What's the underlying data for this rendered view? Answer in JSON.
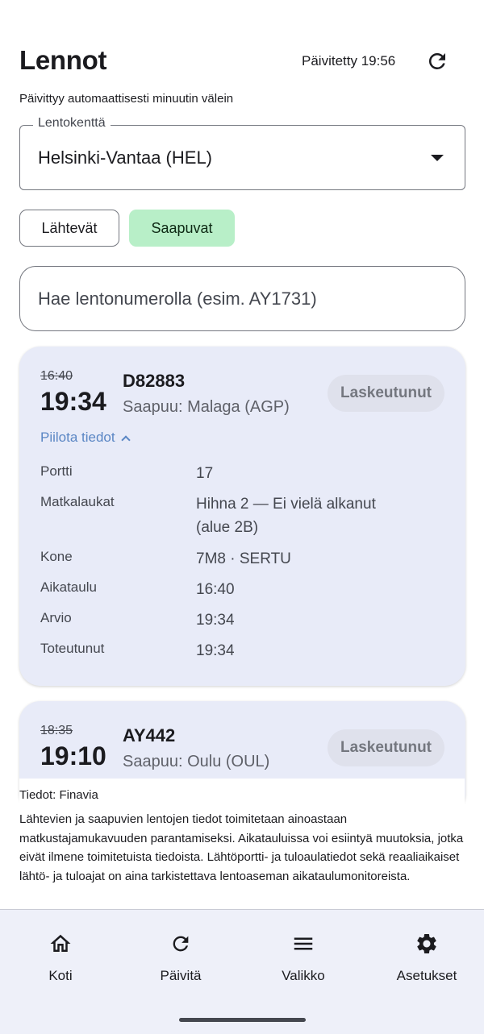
{
  "header": {
    "title": "Lennot",
    "updated_text": "Päivitetty 19:56",
    "auto_update_text": "Päivittyy automaattisesti minuutin välein"
  },
  "airport": {
    "label": "Lentokenttä",
    "value": "Helsinki-Vantaa (HEL)"
  },
  "tabs": [
    {
      "label": "Lähtevät",
      "selected": false
    },
    {
      "label": "Saapuvat",
      "selected": true
    }
  ],
  "search": {
    "placeholder": "Hae lentonumerolla (esim. AY1731)"
  },
  "flights": [
    {
      "scheduled": "16:40",
      "estimated": "19:34",
      "flight_number": "D82883",
      "origin": "Saapuu: Malaga (AGP)",
      "status": "Laskeutunut",
      "toggle_label": "Piilota tiedot",
      "details": [
        {
          "label": "Portti",
          "value": "17"
        },
        {
          "label": "Matkalaukat",
          "value": "Hihna 2 — Ei vielä alkanut (alue 2B)"
        },
        {
          "label": "Kone",
          "value": "7M8 · SERTU"
        },
        {
          "label": "Aikataulu",
          "value": "16:40"
        },
        {
          "label": "Arvio",
          "value": "19:34"
        },
        {
          "label": "Toteutunut",
          "value": "19:34"
        }
      ]
    },
    {
      "scheduled": "18:35",
      "estimated": "19:10",
      "flight_number": "AY442",
      "origin": "Saapuu: Oulu (OUL)",
      "status": "Laskeutunut"
    }
  ],
  "footer": {
    "source": "Tiedot: Finavia",
    "disclaimer": "Lähtevien ja saapuvien lentojen tiedot toimitetaan ainoastaan matkustajamukavuuden parantamiseksi. Aikatauluissa voi esiintyä muutoksia, jotka eivät ilmene toimitetuista tiedoista. Lähtöportti- ja tuloaulatiedot sekä reaaliaikaiset lähtö- ja tuloajat on aina tarkistettava lentoaseman aikataulumonitoreista."
  },
  "bottom_nav": [
    {
      "label": "Koti",
      "icon": "home-icon"
    },
    {
      "label": "Päivitä",
      "icon": "refresh-icon"
    },
    {
      "label": "Valikko",
      "icon": "menu-icon"
    },
    {
      "label": "Asetukset",
      "icon": "gear-icon"
    }
  ],
  "colors": {
    "accent_selected_tab": "#b8efc8",
    "card_background": "#e8ebf8",
    "link": "#5a86c4",
    "nav_background": "#eef0f9"
  }
}
